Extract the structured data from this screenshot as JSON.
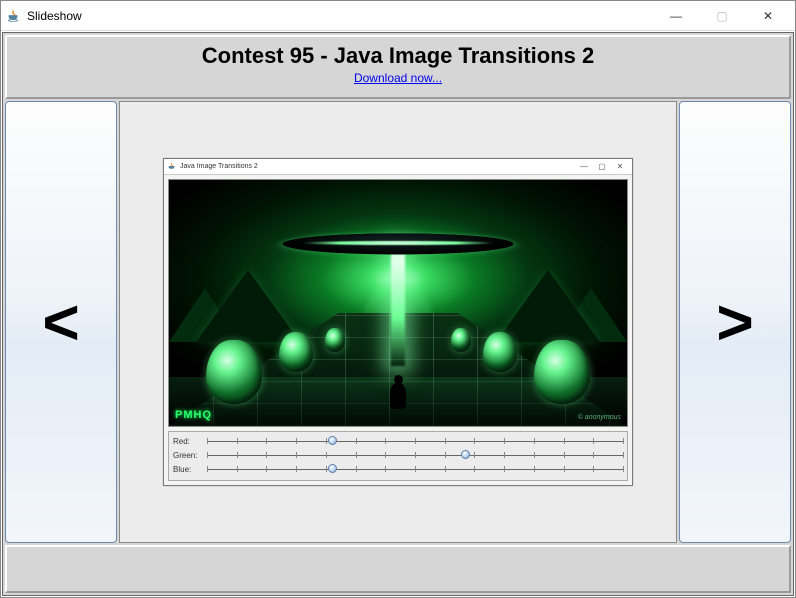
{
  "window": {
    "title": "Slideshow",
    "controls": {
      "minimize": "—",
      "maximize": "▢",
      "close": "✕"
    }
  },
  "header": {
    "title": "Contest 95 - Java Image Transitions 2",
    "download_link": "Download now..."
  },
  "nav": {
    "prev": "<",
    "next": ">"
  },
  "slide": {
    "inner_window_title": "Java Image Transitions 2",
    "inner_controls": {
      "minimize": "—",
      "maximize": "▢",
      "close": "✕"
    },
    "logo": "PMHQ",
    "credit": "© anonymous",
    "sliders": {
      "red": {
        "label": "Red:",
        "value": 30,
        "min": 0,
        "max": 100,
        "ticks": 14
      },
      "green": {
        "label": "Green:",
        "value": 62,
        "min": 0,
        "max": 100,
        "ticks": 14
      },
      "blue": {
        "label": "Blue:",
        "value": 30,
        "min": 0,
        "max": 100,
        "ticks": 14
      }
    }
  }
}
